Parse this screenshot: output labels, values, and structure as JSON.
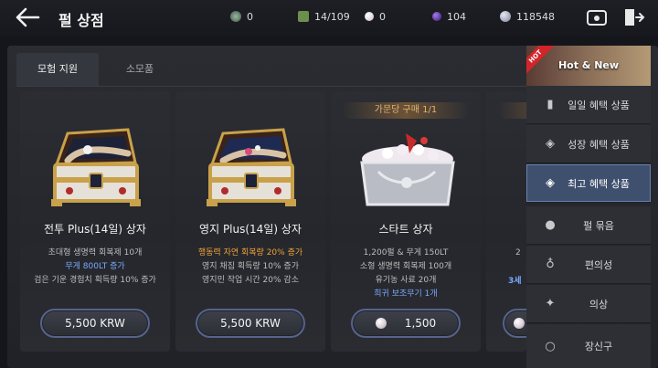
{
  "header": {
    "title": "펄 상점",
    "currencies": [
      {
        "icon": "silver-token-icon",
        "value": "0",
        "color": "#6f8f7a"
      },
      {
        "icon": "weight-icon",
        "value": "14/109",
        "color": "#7a9a55"
      },
      {
        "icon": "pearl-icon",
        "value": "0",
        "color": "#d9cfd8"
      },
      {
        "icon": "purple-gem-icon",
        "value": "104",
        "color": "#6b3fc4"
      },
      {
        "icon": "silver-coin-icon",
        "value": "118548",
        "color": "#b8bfd0"
      }
    ]
  },
  "tabs": [
    {
      "label": "모험 지원",
      "active": true
    },
    {
      "label": "소모품",
      "active": false
    }
  ],
  "cards": [
    {
      "name": "전투 Plus(14일) 상자",
      "lines": [
        {
          "text": "초대형 생명력 회복제 10개",
          "style": "normal"
        },
        {
          "text": "무게 800LT 증가",
          "style": "blue"
        },
        {
          "text": "검은 기운 경험치 획득량 10% 증가",
          "style": "normal"
        }
      ],
      "price": "5,500 KRW",
      "pearl": false
    },
    {
      "name": "영지 Plus(14일) 상자",
      "lines": [
        {
          "text": "행동력 자연 회복량 20% 증가",
          "style": "orange"
        },
        {
          "text": "영지 채집 획득량 10% 증가",
          "style": "normal"
        },
        {
          "text": "영지민 작업 시간 20% 감소",
          "style": "normal"
        }
      ],
      "price": "5,500 KRW",
      "pearl": false
    },
    {
      "limit": "가문당 구매 1/1",
      "name": "스타트 상자",
      "lines": [
        {
          "text": "1,200펄 & 무게 150LT",
          "style": "normal"
        },
        {
          "text": "소형 생명력 회복제 100개",
          "style": "normal"
        },
        {
          "text": "유기농 사료 20개",
          "style": "normal"
        },
        {
          "text": "희귀 보조무기 1개",
          "style": "blue"
        }
      ],
      "price": "1,500",
      "pearl": true
    },
    {
      "partial_lines": [
        "2",
        "3세"
      ],
      "pearl": true
    }
  ],
  "side_menu": {
    "hot_label": "Hot & New",
    "hot_badge": "HOT",
    "items": [
      {
        "label": "일일 혜택 상품",
        "icon": "calendar-icon",
        "active": false
      },
      {
        "label": "성장 혜택 상품",
        "icon": "box-icon",
        "active": false
      },
      {
        "label": "최고 혜택 상품",
        "icon": "gift-box-icon",
        "active": true
      },
      {
        "label": "펄 묶음",
        "icon": "pearl-bundle-icon",
        "active": false
      },
      {
        "label": "편의성",
        "icon": "potion-icon",
        "active": false
      },
      {
        "label": "의상",
        "icon": "outfit-icon",
        "active": false
      },
      {
        "label": "장신구",
        "icon": "ring-icon",
        "active": false
      }
    ]
  }
}
